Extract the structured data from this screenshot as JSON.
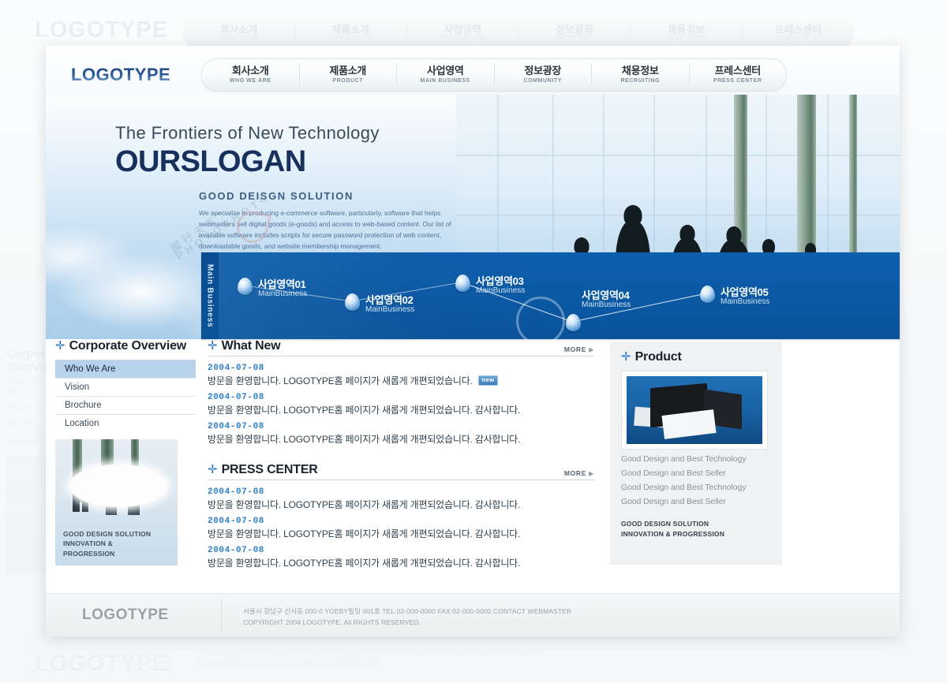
{
  "site": {
    "brand": "LOGOTYPE",
    "watermark_brand": "LOGOTYPE",
    "watermark_brand_bottom": "LOGOTYPE"
  },
  "nav": {
    "items": [
      {
        "kr": "회사소개",
        "en": "WHO WE ARE"
      },
      {
        "kr": "제품소개",
        "en": "PRODUCT"
      },
      {
        "kr": "사업영역",
        "en": "MAIN BUSINESS"
      },
      {
        "kr": "정보광장",
        "en": "COMMUNITY"
      },
      {
        "kr": "채용정보",
        "en": "RECRUITING"
      },
      {
        "kr": "프레스센터",
        "en": "PRESS CENTER"
      }
    ]
  },
  "hero": {
    "tagline": "The Frontiers of New Technology",
    "slogan": "OURSLOGAN",
    "subtitle": "GOOD DEISGN SOLUTION",
    "description": "We specialize in producing e-commerce software, particularly, software that helps webmasters sell digital goods (e-goods) and access to web-based content. Our list of available software includes scripts for secure password protection of web content, downloadable goods, and website membership management.",
    "watermark_line1": "图行天下",
    "watermark_line2": "PHOTOPHOTO"
  },
  "business_strip": {
    "label": "Main Business",
    "nodes": [
      {
        "kr": "사업영역01",
        "en": "MainBusiness"
      },
      {
        "kr": "사업영역02",
        "en": "MainBusiness"
      },
      {
        "kr": "사업영역03",
        "en": "MainBusiness"
      },
      {
        "kr": "사업영역04",
        "en": "MainBusiness"
      },
      {
        "kr": "사업영역05",
        "en": "MainBusiness"
      }
    ]
  },
  "corporate_overview": {
    "title": "Corporate Overview",
    "items": [
      {
        "label": "Who We Are",
        "active": true
      },
      {
        "label": "Vision",
        "active": false
      },
      {
        "label": "Brochure",
        "active": false
      },
      {
        "label": "Location",
        "active": false
      }
    ],
    "promo_caption_line1": "GOOD DESIGN SOLUTION",
    "promo_caption_line2": "INNOVATION &",
    "promo_caption_line3": "PROGRESSION"
  },
  "what_new": {
    "title": "What New",
    "more_label": "MORE",
    "more_arrow": "▶",
    "rows": [
      {
        "date": "2004-07-08",
        "text": "방문을 환영합니다. LOGOTYPE홈 페이지가 새롭게 개편되었습니다.",
        "badge": "new"
      },
      {
        "date": "2004-07-08",
        "text": "방문을 환영합니다. LOGOTYPE홈 페이지가 새롭게 개편되었습니다. 감사합니다.",
        "badge": ""
      },
      {
        "date": "2004-07-08",
        "text": "방문을 환영합니다. LOGOTYPE홈 페이지가 새롭게 개편되었습니다. 감사합니다.",
        "badge": ""
      }
    ]
  },
  "press_center": {
    "title": "PRESS CENTER",
    "more_label": "MORE",
    "more_arrow": "▶",
    "rows": [
      {
        "date": "2004-07-08",
        "text": "방문을 환영합니다. LOGOTYPE홈 페이지가 새롭게 개편되었습니다. 감사합니다."
      },
      {
        "date": "2004-07-08",
        "text": "방문을 환영합니다. LOGOTYPE홈 페이지가 새롭게 개편되었습니다. 감사합니다."
      },
      {
        "date": "2004-07-08",
        "text": "방문을 환영합니다. LOGOTYPE홈 페이지가 새롭게 개편되었습니다. 감사합니다."
      }
    ]
  },
  "product": {
    "title": "Product",
    "lines": [
      "Good Design and Best Technology",
      "Good Design and Best Seller",
      "Good Design and Best Technology",
      "Good Design and Best Seller"
    ],
    "caption_line1": "GOOD DESIGN SOLUTION",
    "caption_line2": "INNOVATION & PROGRESSION"
  },
  "footer": {
    "logo": "LOGOTYPE",
    "line1": "서울시 강남구 신사동 000-0 YOEBY빌딩 001호 TEL:02-000-0000 FAX:02-000-0000 CONTACT WEBMASTER",
    "line2": "COPYRIGHT 2004 LOGOTYPE. All RIGHTS RESERVED."
  },
  "colors": {
    "accent_blue": "#0b59a4",
    "link_blue": "#2f7fc9",
    "brand_dark": "#1d3f75",
    "active_menu": "#b9d3ea"
  }
}
